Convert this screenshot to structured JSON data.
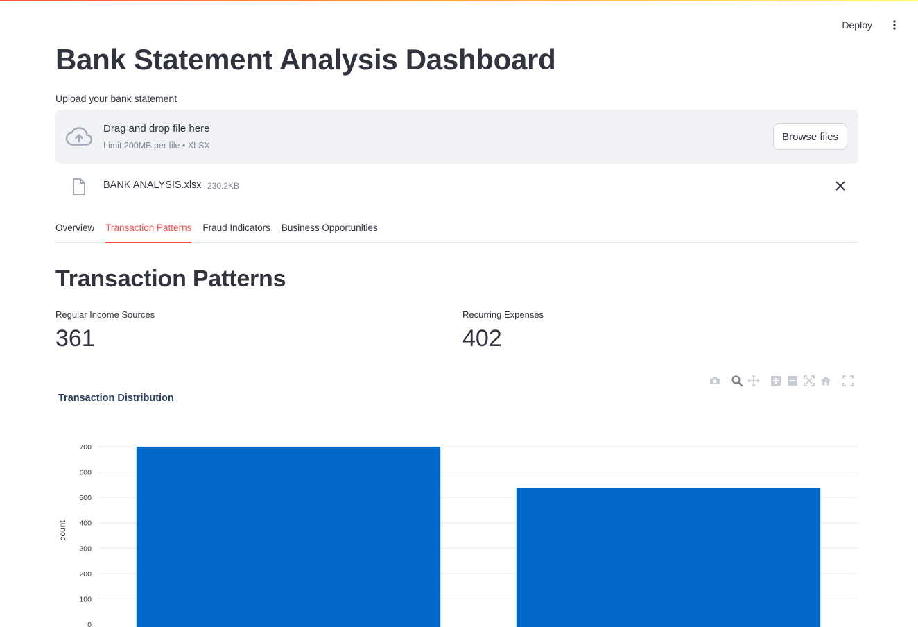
{
  "header": {
    "deploy_label": "Deploy"
  },
  "page": {
    "title": "Bank Statement Analysis Dashboard"
  },
  "uploader": {
    "label": "Upload your bank statement",
    "drop_title": "Drag and drop file here",
    "drop_limit": "Limit 200MB per file • XLSX",
    "browse_label": "Browse files",
    "file": {
      "name": "BANK ANALYSIS.xlsx",
      "size": "230.2KB"
    }
  },
  "tabs": [
    {
      "label": "Overview",
      "active": false
    },
    {
      "label": "Transaction Patterns",
      "active": true
    },
    {
      "label": "Fraud Indicators",
      "active": false
    },
    {
      "label": "Business Opportunities",
      "active": false
    }
  ],
  "section": {
    "title": "Transaction Patterns"
  },
  "metrics": [
    {
      "label": "Regular Income Sources",
      "value": "361"
    },
    {
      "label": "Recurring Expenses",
      "value": "402"
    }
  ],
  "modebar": [
    "camera-icon",
    "zoom-icon",
    "pan-icon",
    "zoom-in-icon",
    "zoom-out-icon",
    "autoscale-icon",
    "reset-axes-icon",
    "fullscreen-icon"
  ],
  "colors": {
    "accent": "#ff4b4b",
    "bar": "#0068c9",
    "text": "#31333f"
  },
  "chart_data": {
    "type": "bar",
    "title": "Transaction Distribution",
    "ylabel": "count",
    "xlabel": "",
    "categories": [
      "",
      ""
    ],
    "values": [
      700,
      537
    ],
    "yticks": [
      0,
      100,
      200,
      300,
      400,
      500,
      600,
      700
    ],
    "ylim": [
      0,
      737
    ],
    "grid": true
  }
}
